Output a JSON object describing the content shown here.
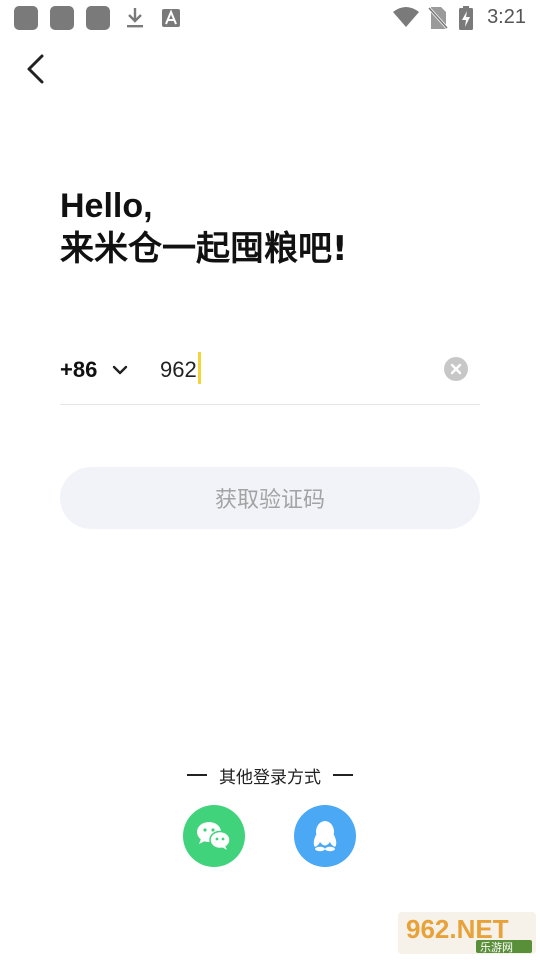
{
  "status_bar": {
    "time": "3:21",
    "icons": [
      "app-icon",
      "app-icon",
      "app-icon",
      "download-icon",
      "font-icon",
      "wifi-icon",
      "no-sim-icon",
      "battery-charging-icon"
    ]
  },
  "greeting": {
    "line1": "Hello,",
    "line2": "来米仓一起囤粮吧!"
  },
  "phone": {
    "country_code": "+86",
    "value": "962"
  },
  "get_code_button": "获取验证码",
  "other_login": {
    "label": "其他登录方式",
    "options": [
      "wechat",
      "qq"
    ]
  },
  "watermark": {
    "brand": "962.NET",
    "sub": "乐游网"
  },
  "colors": {
    "wechat": "#41d37b",
    "qq": "#4aa8f5",
    "caret": "#f2d33a",
    "button_bg": "#f2f3f8",
    "button_text": "#a3a3a3"
  }
}
